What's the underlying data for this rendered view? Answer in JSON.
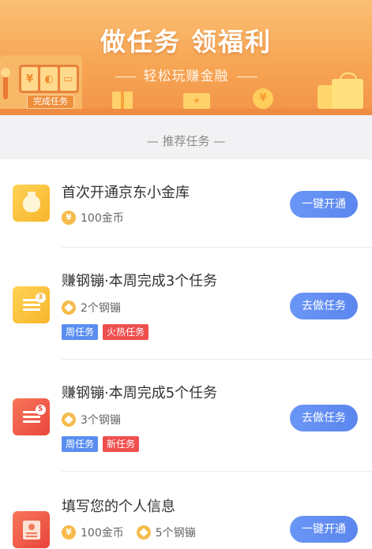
{
  "banner": {
    "title": "做任务 领福利",
    "subtitle": "轻松玩赚金融",
    "slot_label": "完成任务",
    "slot_symbols": [
      "¥",
      "◐",
      "▭"
    ],
    "coin_symbol": "¥",
    "box_symbol": "★"
  },
  "section": {
    "title": "— 推荐任务 —"
  },
  "colors": {
    "banner": "#f6a452",
    "button": "#5b86ee",
    "tag_blue": "#5a8df0",
    "tag_red": "#ef4f4f",
    "coin": "#f6bb4b"
  },
  "tasks": [
    {
      "title": "首次开通京东小金库",
      "icon": "money-bag-icon",
      "rewards": [
        {
          "icon": "coin-icon",
          "symbol": "¥",
          "text": "100金币"
        }
      ],
      "tags": [],
      "button": "一键开通"
    },
    {
      "title": "赚钢镚·本周完成3个任务",
      "icon": "task-list-icon",
      "badge": "3",
      "rewards": [
        {
          "icon": "steel-coin-icon",
          "text": "2个钢镚"
        }
      ],
      "tags": [
        {
          "text": "周任务",
          "color": "blue"
        },
        {
          "text": "火热任务",
          "color": "red"
        }
      ],
      "button": "去做任务"
    },
    {
      "title": "赚钢镚·本周完成5个任务",
      "icon": "task-list-icon",
      "badge": "5",
      "rewards": [
        {
          "icon": "steel-coin-icon",
          "text": "3个钢镚"
        }
      ],
      "tags": [
        {
          "text": "周任务",
          "color": "blue"
        },
        {
          "text": "新任务",
          "color": "red"
        }
      ],
      "button": "去做任务"
    },
    {
      "title": "填写您的个人信息",
      "icon": "profile-card-icon",
      "rewards": [
        {
          "icon": "coin-icon",
          "symbol": "¥",
          "text": "100金币"
        },
        {
          "icon": "steel-coin-icon",
          "text": "5个钢镚"
        }
      ],
      "tags": [],
      "button": "一键开通"
    }
  ]
}
